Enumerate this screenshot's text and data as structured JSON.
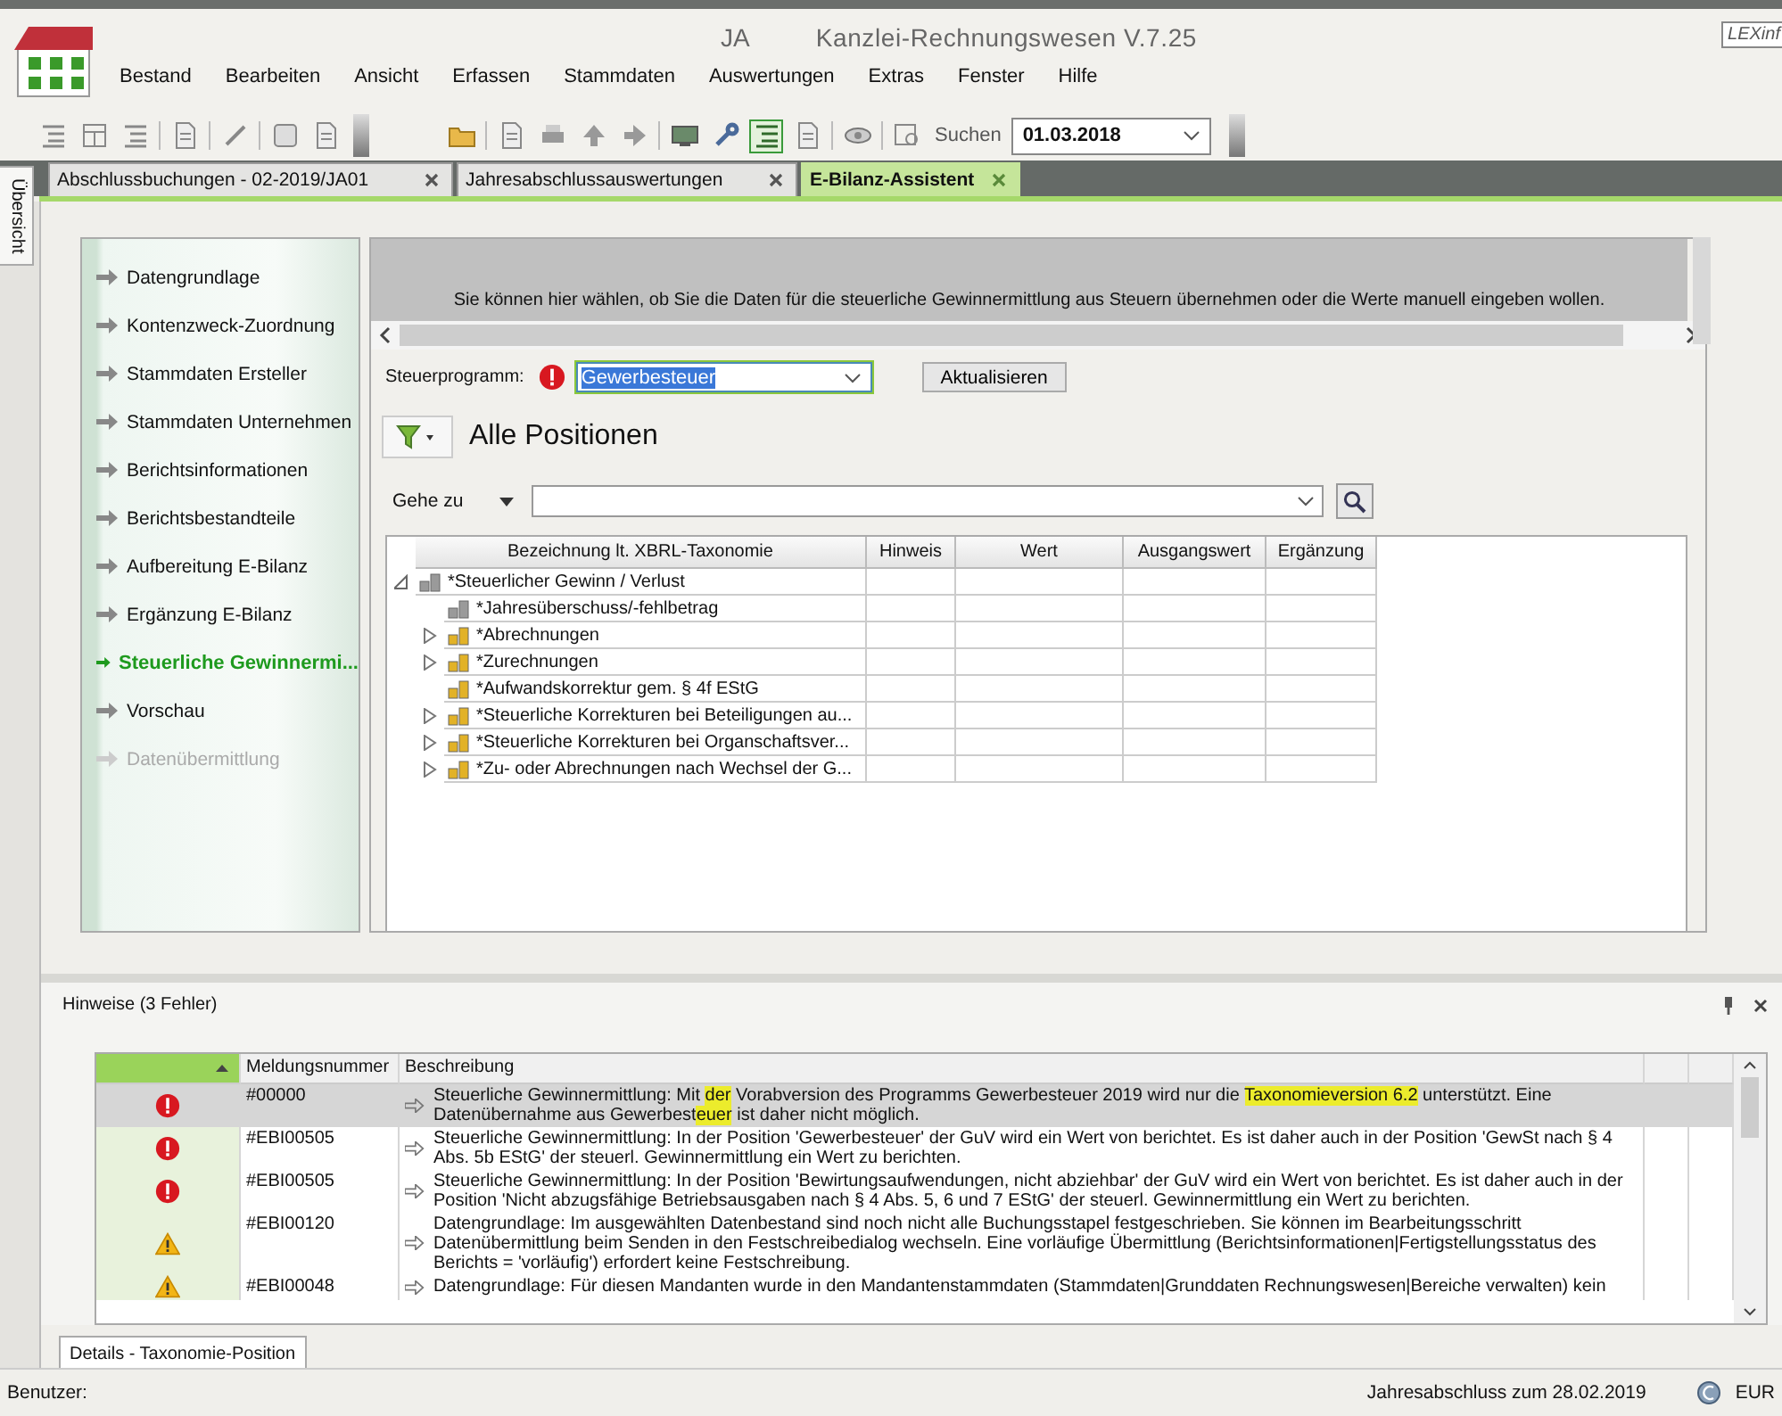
{
  "header": {
    "title_suffix": "JA",
    "app_name": "Kanzlei-Rechnungswesen V.7.25",
    "brand": "LEXinf"
  },
  "menu": [
    "Bestand",
    "Bearbeiten",
    "Ansicht",
    "Erfassen",
    "Stammdaten",
    "Auswertungen",
    "Extras",
    "Fenster",
    "Hilfe"
  ],
  "toolbar": {
    "search_label": "Suchen",
    "date": "01.03.2018",
    "indent_view": {
      "on": true
    }
  },
  "tabs": [
    {
      "label": "Abschlussbuchungen  - 02-2019/JA01",
      "selected": false
    },
    {
      "label": "Jahresabschlussauswertungen",
      "selected": false
    },
    {
      "label": "E-Bilanz-Assistent",
      "selected": true
    }
  ],
  "side_tab": "Übersicht",
  "nav": [
    {
      "label": "Datengrundlage",
      "selected": false,
      "disabled": false
    },
    {
      "label": "Kontenzweck-Zuordnung",
      "selected": false,
      "disabled": false
    },
    {
      "label": "Stammdaten Ersteller",
      "selected": false,
      "disabled": false
    },
    {
      "label": "Stammdaten Unternehmen",
      "selected": false,
      "disabled": false
    },
    {
      "label": "Berichtsinformationen",
      "selected": false,
      "disabled": false
    },
    {
      "label": "Berichtsbestandteile",
      "selected": false,
      "disabled": false
    },
    {
      "label": "Aufbereitung E-Bilanz",
      "selected": false,
      "disabled": false
    },
    {
      "label": "Ergänzung E-Bilanz",
      "selected": false,
      "disabled": false
    },
    {
      "label": "Steuerliche Gewinnermi...",
      "selected": true,
      "disabled": false
    },
    {
      "label": "Vorschau",
      "selected": false,
      "disabled": false
    },
    {
      "label": "Datenübermittlung",
      "selected": false,
      "disabled": true
    }
  ],
  "info_text": "Sie können hier wählen, ob Sie die Daten für die steuerliche Gewinnermittlung aus Steuern übernehmen oder die Werte manuell eingeben wollen.",
  "tax_program": {
    "label": "Steuerprogramm:",
    "value": "Gewerbesteuer",
    "error": true
  },
  "refresh_button": "Aktualisieren",
  "view_title": "Alle Positionen",
  "goto": {
    "label": "Gehe zu"
  },
  "grid": {
    "columns": [
      "Bezeichnung lt. XBRL-Taxonomie",
      "Hinweis",
      "Wert",
      "Ausgangswert",
      "Ergänzung"
    ],
    "rows": [
      {
        "label": "*Steuerlicher Gewinn / Verlust",
        "kind": "gray",
        "expanded": true,
        "children": [
          {
            "label": "*Jahresüberschuss/-fehlbetrag",
            "kind": "gray"
          },
          {
            "label": "*Abrechnungen",
            "kind": "gold",
            "expanded": false
          },
          {
            "label": "*Zurechnungen",
            "kind": "gold",
            "expanded": false
          },
          {
            "label": "*Aufwandskorrektur gem. § 4f EStG",
            "kind": "gold"
          },
          {
            "label": "*Steuerliche Korrekturen bei Beteiligungen au...",
            "kind": "gold",
            "expanded": false
          },
          {
            "label": "*Steuerliche Korrekturen bei Organschaftsver...",
            "kind": "gold",
            "expanded": false
          },
          {
            "label": "*Zu- oder Abrechnungen nach Wechsel der G...",
            "kind": "gold",
            "expanded": false
          }
        ]
      }
    ]
  },
  "hints": {
    "title": "Hinweise (3 Fehler)",
    "columns": [
      "Meldungsnummer",
      "Beschreibung"
    ],
    "rows": [
      {
        "kind": "error",
        "code": "#00000",
        "selected": true,
        "text": [
          {
            "text": "Steuerliche Gewinnermittlung: Mit ",
            "highlighted": false
          },
          {
            "text": "der",
            "highlighted": true
          },
          {
            "text": " Vorabversion des Programms Gewerbesteuer 2019 wird nur die ",
            "highlighted": false
          },
          {
            "text": "Taxonomieversion 6.2",
            "highlighted": true
          },
          {
            "text": " unterstützt. Eine Datenübernahme aus Gewerbest",
            "highlighted": false
          },
          {
            "text": "euer",
            "highlighted": true
          },
          {
            "text": " ist daher nicht möglich.",
            "highlighted": false
          }
        ]
      },
      {
        "kind": "error",
        "code": "#EBI00505",
        "selected": false,
        "text": [
          {
            "text": "Steuerliche Gewinnermittlung: In der Position 'Gewerbesteuer' der GuV wird ein Wert von berichtet. Es ist daher auch in der Position 'GewSt nach § 4 Abs. 5b EStG' der steuerl. Gewinnermittlung ein Wert zu berichten.",
            "highlighted": false
          }
        ]
      },
      {
        "kind": "error",
        "code": "#EBI00505",
        "selected": false,
        "text": [
          {
            "text": "Steuerliche Gewinnermittlung: In der Position 'Bewirtungsaufwendungen, nicht abziehbar' der GuV wird ein Wert von berichtet. Es ist daher auch in der Position 'Nicht abzugsfähige Betriebsausgaben nach § 4 Abs. 5, 6 und 7 EStG' der steuerl. Gewinnermittlung ein Wert zu berichten.",
            "highlighted": false
          }
        ]
      },
      {
        "kind": "warning",
        "code": "#EBI00120",
        "selected": false,
        "text": [
          {
            "text": "Datengrundlage: Im ausgewählten Datenbestand sind noch nicht alle Buchungsstapel festgeschrieben. Sie können im Bearbeitungsschritt Datenübermittlung beim Senden in den Festschreibedialog wechseln. Eine vorläufige Übermittlung (Berichtsinformationen|Fertigstellungsstatus des Berichts = 'vorläufig') erfordert keine Festschreibung.",
            "highlighted": false
          }
        ]
      },
      {
        "kind": "warning",
        "code": "#EBI00048",
        "selected": false,
        "text": [
          {
            "text": "Datengrundlage: Für diesen Mandanten wurde in den Mandantenstammdaten (Stammdaten|Grunddaten Rechnungswesen|Bereiche verwalten) kein",
            "highlighted": false
          }
        ]
      }
    ]
  },
  "details_tab": "Details - Taxonomie-Position",
  "status": {
    "user": "Benutzer:",
    "period": "Jahresabschluss zum 28.02.2019",
    "currency": "EUR"
  }
}
